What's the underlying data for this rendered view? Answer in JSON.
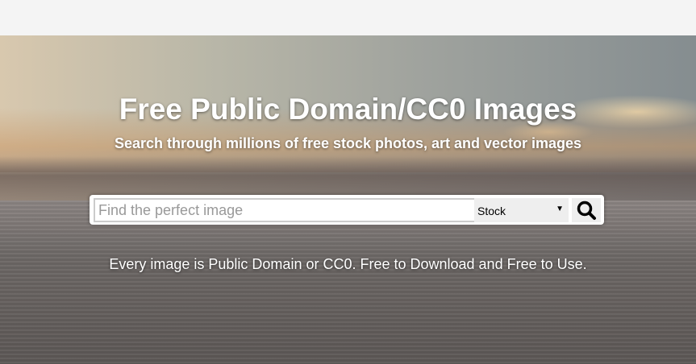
{
  "hero": {
    "title": "Free Public Domain/CC0 Images",
    "subtitle": "Search through millions of free stock photos, art and vector images",
    "tagline": "Every image is Public Domain or CC0. Free to Download and Free to Use."
  },
  "search": {
    "placeholder": "Find the perfect image",
    "value": "",
    "category_selected": "Stock",
    "button_icon": "search-icon"
  }
}
